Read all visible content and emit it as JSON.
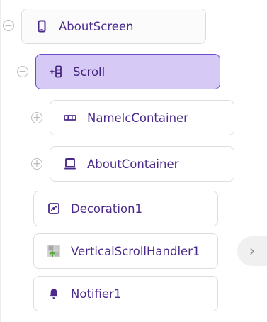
{
  "tree": {
    "root": {
      "label": "AboutScreen",
      "toggle": "−",
      "icon": "phone-icon"
    },
    "scroll": {
      "label": "Scroll",
      "toggle": "−",
      "icon": "vertical-scroll-arrangement-icon",
      "selected": true
    },
    "items": [
      {
        "label": "NamelcContainer",
        "toggle": "+",
        "icon": "horizontal-arrangement-icon"
      },
      {
        "label": "AboutContainer",
        "toggle": "+",
        "icon": "vertical-arrangement-icon"
      },
      {
        "label": "Decoration1",
        "icon": "decoration-icon"
      },
      {
        "label": "VerticalScrollHandler1",
        "icon": "extension-icon"
      },
      {
        "label": "Notifier1",
        "icon": "bell-icon"
      }
    ]
  },
  "right_nav": {
    "label": "›",
    "icon": "chevron-right-icon"
  },
  "colors": {
    "accent": "#4b2a8c",
    "selected_bg": "#d7c9f6",
    "selected_border": "#6d4bcf",
    "border": "#dddddd"
  }
}
